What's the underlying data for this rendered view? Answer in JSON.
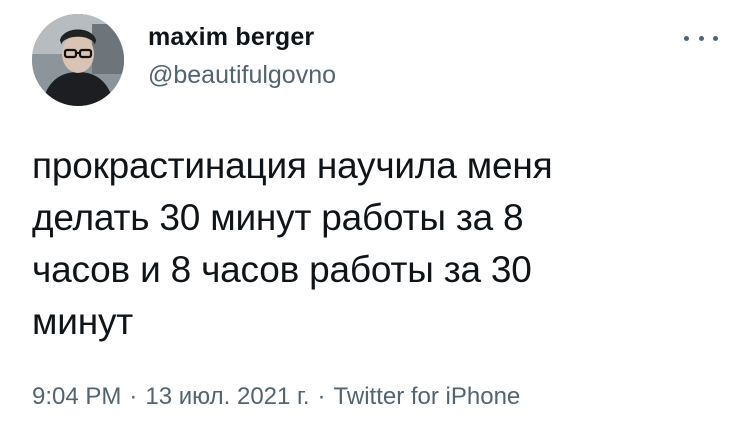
{
  "author": {
    "display_name": "maxim berger",
    "handle": "@beautifulgovno",
    "avatar_icon": "profile-photo"
  },
  "menu": {
    "icon": "more-horizontal-icon"
  },
  "tweet": {
    "text_lines": [
      "прокрастинация научила меня",
      "делать 30 минут работы за 8",
      "часов и 8 часов работы за 30",
      "минут"
    ]
  },
  "meta": {
    "time": "9:04 PM",
    "separator": "·",
    "date": "13 июл. 2021 г.",
    "source": "Twitter for iPhone"
  },
  "colors": {
    "primary_text": "#0f1419",
    "secondary_text": "#536471",
    "background": "#ffffff"
  }
}
